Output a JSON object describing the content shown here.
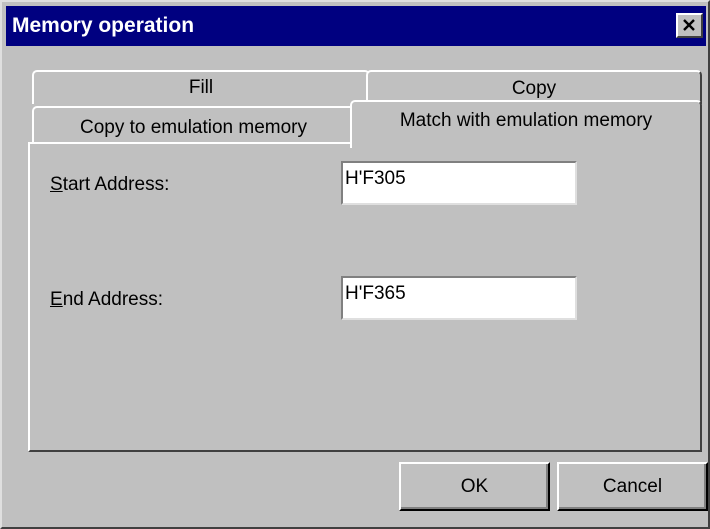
{
  "window": {
    "title": "Memory operation",
    "close_icon": "close-icon"
  },
  "tabs": {
    "row_back": [
      {
        "label": "Fill"
      },
      {
        "label": "Copy"
      }
    ],
    "row_front": [
      {
        "label": "Copy to emulation memory"
      },
      {
        "label": "Match with emulation memory",
        "selected": true
      }
    ]
  },
  "form": {
    "start_address": {
      "label_mnemonic": "S",
      "label_rest": "tart Address:",
      "value": "H'F305"
    },
    "end_address": {
      "label_mnemonic": "E",
      "label_rest": "nd Address:",
      "value": "H'F365"
    }
  },
  "buttons": {
    "ok": "OK",
    "cancel": "Cancel"
  },
  "colors": {
    "titlebar": "#000080",
    "face": "#c0c0c0"
  }
}
